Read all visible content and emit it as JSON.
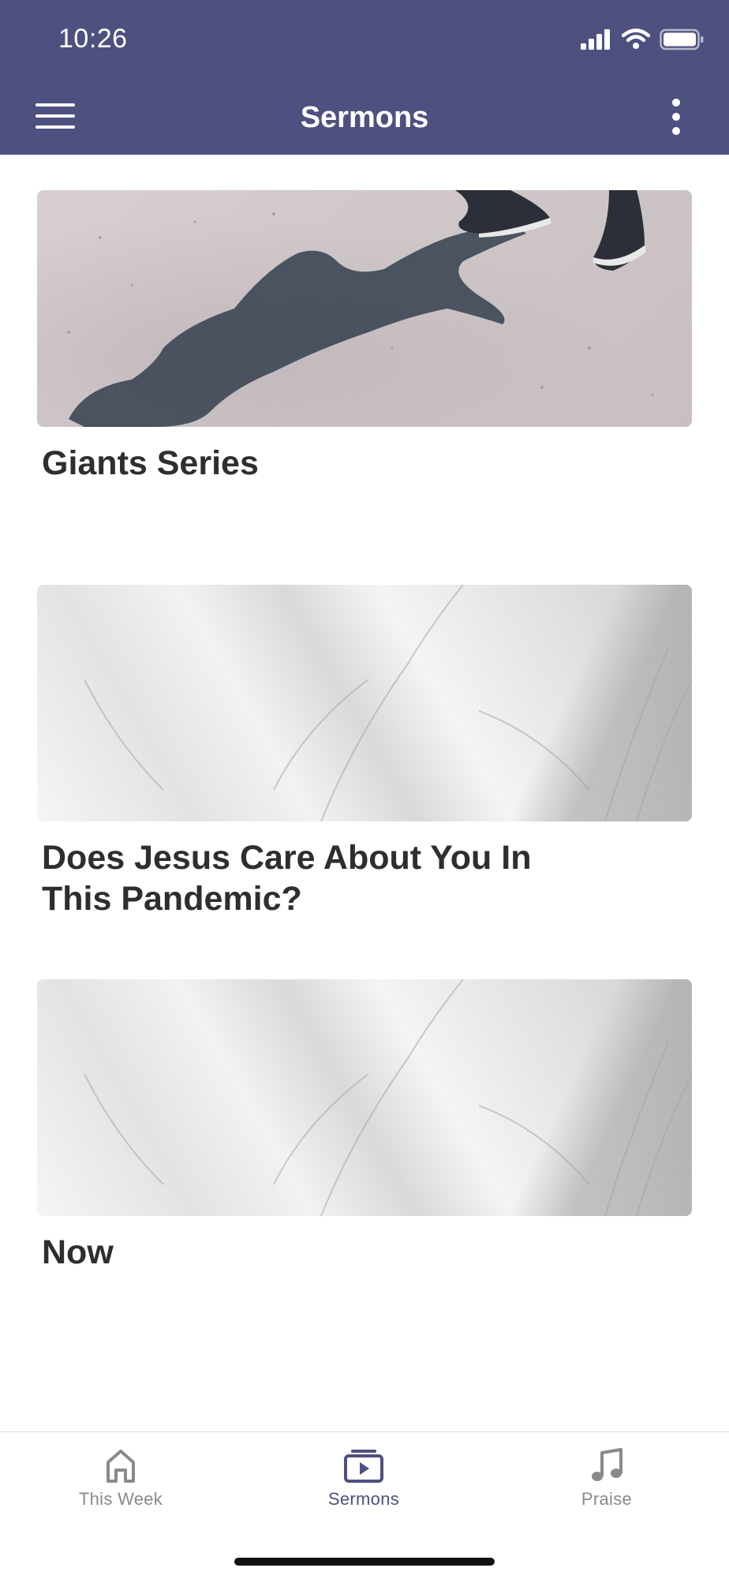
{
  "status_bar": {
    "time": "10:26"
  },
  "header": {
    "title": "Sermons"
  },
  "cards": [
    {
      "title": "Giants Series",
      "image": "shadow-on-sand-photo"
    },
    {
      "title": "Does Jesus Care About You In This Pandemic?",
      "image": "marble-texture-photo"
    },
    {
      "title": "Now",
      "image": "marble-texture-photo"
    }
  ],
  "tab_bar": {
    "tabs": [
      {
        "label": "This Week",
        "icon": "home-icon",
        "active": false
      },
      {
        "label": "Sermons",
        "icon": "video-library-icon",
        "active": true
      },
      {
        "label": "Praise",
        "icon": "music-note-icon",
        "active": false
      }
    ]
  },
  "colors": {
    "header_bg": "#4e5080",
    "active_tab": "#4e5080",
    "inactive_tab": "#8a8a8a",
    "title_text": "#2e2e2e"
  }
}
